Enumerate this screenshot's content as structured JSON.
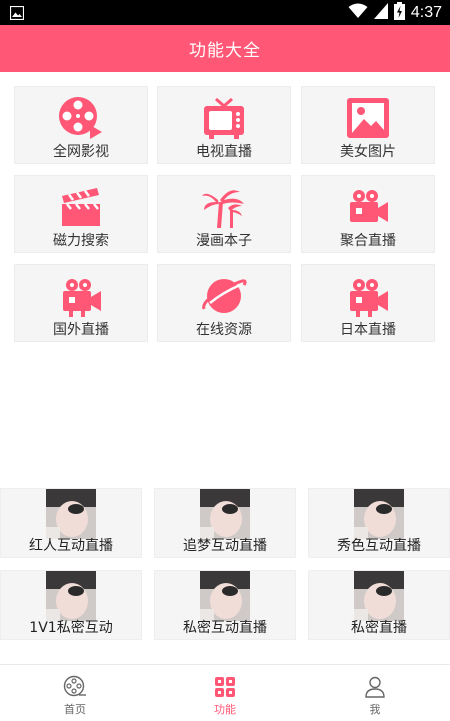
{
  "status_bar": {
    "time": "4:37",
    "icons": [
      "image-notification-icon",
      "wifi-icon",
      "signal-icon",
      "battery-charging-icon"
    ]
  },
  "header": {
    "title": "功能大全"
  },
  "features": [
    {
      "label": "全网影视",
      "icon": "film-reel-icon"
    },
    {
      "label": "电视直播",
      "icon": "tv-icon"
    },
    {
      "label": "美女图片",
      "icon": "picture-icon"
    },
    {
      "label": "磁力搜索",
      "icon": "clapperboard-icon"
    },
    {
      "label": "漫画本子",
      "icon": "palm-tree-icon"
    },
    {
      "label": "聚合直播",
      "icon": "video-camera-icon"
    },
    {
      "label": "国外直播",
      "icon": "video-camera-icon"
    },
    {
      "label": "在线资源",
      "icon": "planet-icon"
    },
    {
      "label": "日本直播",
      "icon": "video-camera-icon"
    }
  ],
  "live_rooms": [
    {
      "label": "红人互动直播"
    },
    {
      "label": "追梦互动直播"
    },
    {
      "label": "秀色互动直播"
    },
    {
      "label": "1V1私密互动"
    },
    {
      "label": "私密互动直播"
    },
    {
      "label": "私密直播"
    }
  ],
  "bottom_nav": {
    "active_index": 1,
    "items": [
      {
        "label": "首页",
        "icon": "film-reel-icon"
      },
      {
        "label": "功能",
        "icon": "grid-icon"
      },
      {
        "label": "我",
        "icon": "user-icon"
      }
    ]
  },
  "colors": {
    "accent": "#ff5775",
    "tile_bg": "#f5f5f5",
    "status_bar": "#000000"
  }
}
